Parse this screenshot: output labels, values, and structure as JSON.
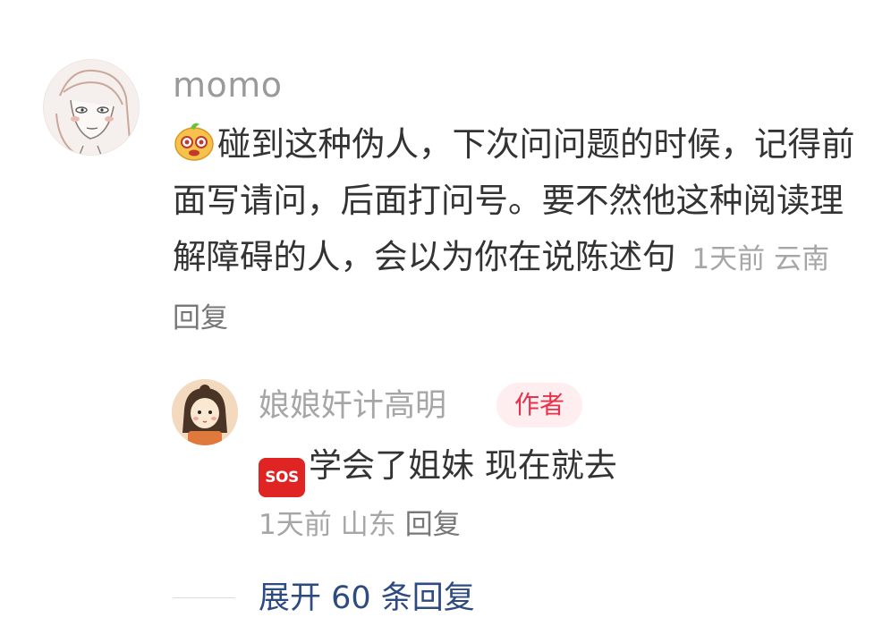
{
  "comment": {
    "username": "momo",
    "text": "碰到这种伪人，下次问问题的时候，记得前面写请问，后面打问号。要不然他这种阅读理解障碍的人，会以为你在说陈述句",
    "time": "1天前",
    "location": "云南",
    "reply_label": "回复"
  },
  "reply": {
    "username": "娘娘奸计高明",
    "badge": "作者",
    "sos_label": "SOS",
    "text": "学会了姐妹 现在就去",
    "time": "1天前",
    "location": "山东",
    "reply_label": "回复"
  },
  "expand": {
    "label": "展开 60 条回复"
  },
  "colors": {
    "link_blue": "#2d4b7f",
    "badge_red": "#e8314b",
    "badge_bg": "#ffeef0",
    "meta_gray": "#a6a6a6"
  }
}
